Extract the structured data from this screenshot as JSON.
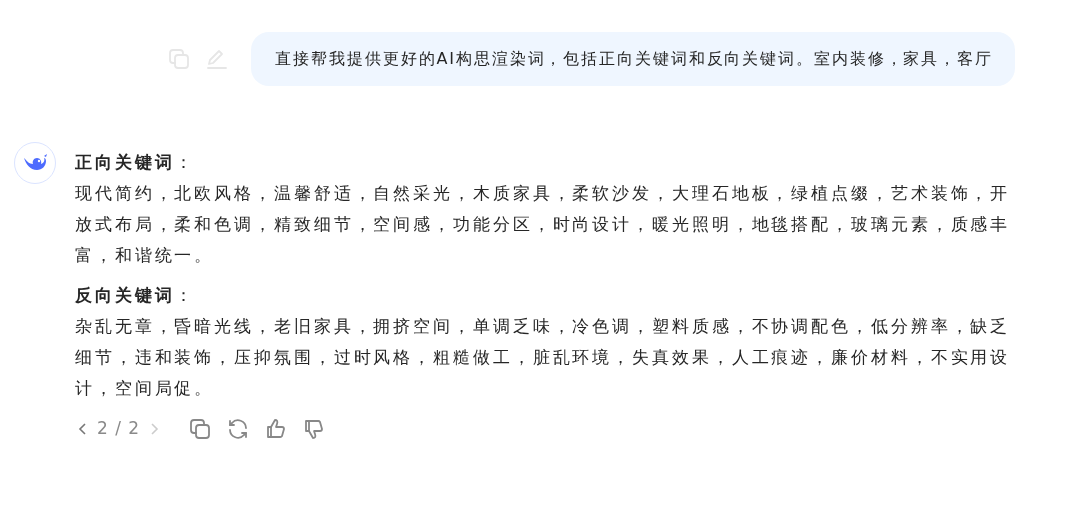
{
  "user_message": {
    "text": "直接帮我提供更好的AI构思渲染词，包括正向关键词和反向关键词。室内装修，家具，客厅"
  },
  "reply": {
    "sections": [
      {
        "heading": "**正向关键词**：",
        "body": "现代简约，北欧风格，温馨舒适，自然采光，木质家具，柔软沙发，大理石地板，绿植点缀，艺术装饰，开放式布局，柔和色调，精致细节，空间感，功能分区，时尚设计，暖光照明，地毯搭配，玻璃元素，质感丰富，和谐统一。"
      },
      {
        "heading": "**反向关键词**：",
        "body": "杂乱无章，昏暗光线，老旧家具，拥挤空间，单调乏味，冷色调，塑料质感，不协调配色，低分辨率，缺乏细节，违和装饰，压抑氛围，过时风格，粗糙做工，脏乱环境，失真效果，人工痕迹，廉价材料，不实用设计，空间局促。"
      }
    ]
  },
  "pager": {
    "text": "2 / 2",
    "prev_disabled": false,
    "next_disabled": true
  }
}
